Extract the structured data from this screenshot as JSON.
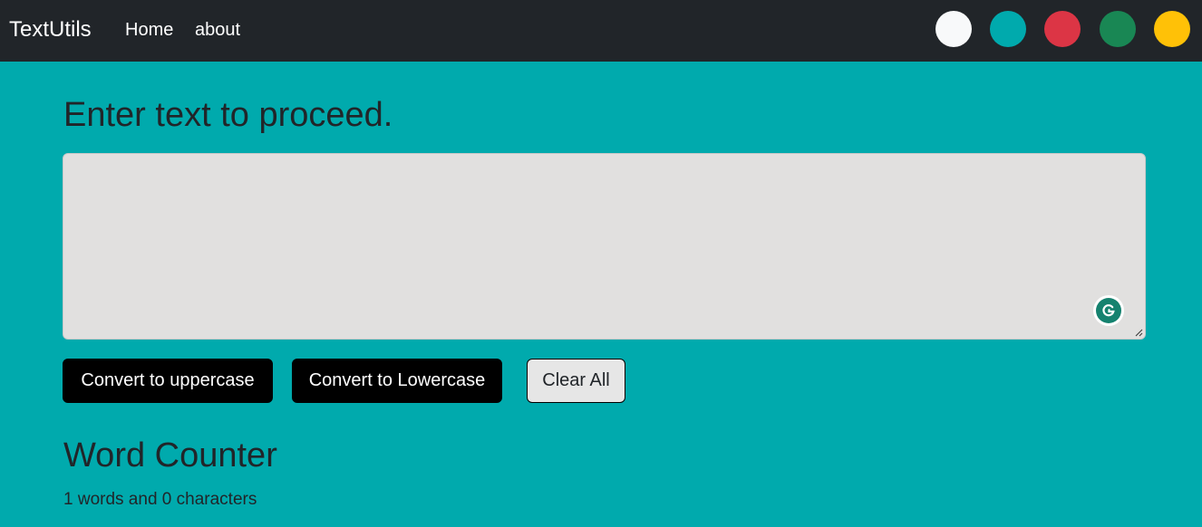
{
  "navbar": {
    "brand": "TextUtils",
    "links": [
      {
        "label": "Home"
      },
      {
        "label": "about"
      }
    ],
    "theme_swatches": [
      {
        "name": "white",
        "color": "#f8f9fa"
      },
      {
        "name": "teal",
        "color": "#00aaad"
      },
      {
        "name": "red",
        "color": "#dc3545"
      },
      {
        "name": "green",
        "color": "#198754"
      },
      {
        "name": "yellow",
        "color": "#ffc107"
      }
    ]
  },
  "main": {
    "heading": "Enter text to proceed.",
    "textarea": {
      "value": "",
      "placeholder": ""
    },
    "buttons": {
      "uppercase": "Convert to uppercase",
      "lowercase": "Convert to Lowercase",
      "clear": "Clear All"
    }
  },
  "summary": {
    "title": "Word Counter",
    "stats": "1 words and 0 characters"
  },
  "colors": {
    "background": "#00aaad",
    "navbar": "#212529",
    "textarea_bg": "#e1e0df",
    "grammarly": "#15826f"
  }
}
